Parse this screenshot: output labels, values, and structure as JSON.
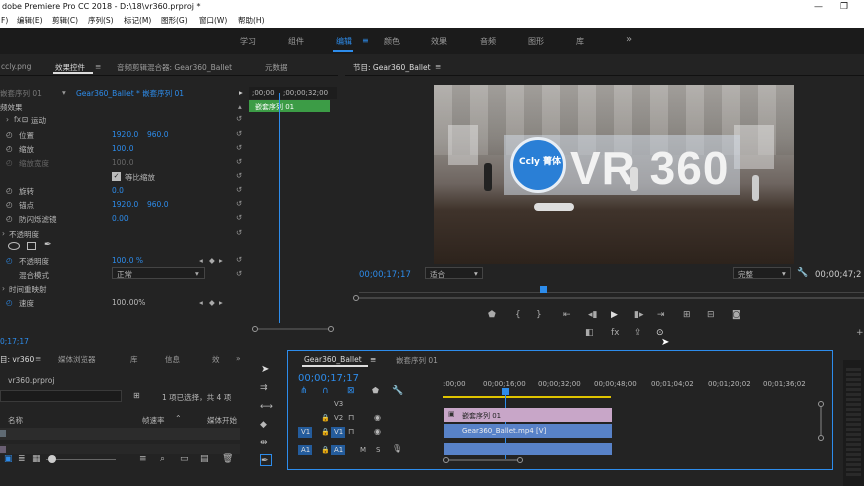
{
  "titlebar": {
    "text": "dobe Premiere Pro CC 2018 - D:\\18\\vr360.prproj *",
    "minimize": "—",
    "restore": "❐"
  },
  "menu": [
    "F)",
    "编辑(E)",
    "剪辑(C)",
    "序列(S)",
    "标记(M)",
    "图形(G)",
    "窗口(W)",
    "帮助(H)"
  ],
  "workspaces": [
    "学习",
    "组件",
    "编辑",
    "颜色",
    "效果",
    "音频",
    "图形",
    "库"
  ],
  "workspace_active_index": 2,
  "left_panel": {
    "tabs": [
      "ccly.png",
      "效果控件",
      "音频剪辑混合器: Gear360_Ballet",
      "元数据"
    ],
    "clip_path_left": "嵌套序列 01",
    "clip_path_right": "Gear360_Ballet * 嵌套序列 01",
    "video_effects": "频效果",
    "motion": "运动",
    "properties": [
      {
        "name": "位置",
        "v1": "1920.0",
        "v2": "960.0"
      },
      {
        "name": "缩放",
        "v1": "100.0",
        "v2": ""
      },
      {
        "name": "缩放宽度",
        "v1": "100.0",
        "v2": ""
      },
      {
        "name": "旋转",
        "v1": "0.0",
        "v2": ""
      },
      {
        "name": "锚点",
        "v1": "1920.0",
        "v2": "960.0"
      },
      {
        "name": "防闪烁滤镜",
        "v1": "0.00",
        "v2": ""
      }
    ],
    "uniform_scale": "等比缩放",
    "opacity": "不透明度",
    "opacity_value": "100.0 %",
    "blend_mode_label": "混合模式",
    "blend_mode_value": "正常",
    "time_remap": "时间重映射",
    "speed_label": "速度",
    "speed_value": "100.00%",
    "timecode": "0;17;17",
    "mini_ruler": [
      ";00;00",
      ";00;00;32;00"
    ],
    "mini_clip": "嵌套序列 01"
  },
  "program": {
    "title": "节目: Gear360_Ballet",
    "video_text": "VR 360",
    "logo_text": "Ccly 菁体",
    "timecode": "00;00;17;17",
    "fit": "适合",
    "quality": "完整",
    "duration": "00;00;47;2"
  },
  "project": {
    "tabs": [
      "目: vr360",
      "媒体浏览器",
      "库",
      "信息",
      "效"
    ],
    "file": "vr360.prproj",
    "selection": "1 项已选择，共 4 项",
    "col_name": "名称",
    "col_rate": "帧速率",
    "col_start": "媒体开始"
  },
  "timeline": {
    "tabs": [
      "Gear360_Ballet",
      "嵌套序列 01"
    ],
    "timecode": "00;00;17;17",
    "ruler": [
      ":00;00",
      "00;00;16;00",
      "00;00;32;00",
      "00;00;48;00",
      "00;01;04;02",
      "00;01;20;02",
      "00;01;36;02"
    ],
    "tracks": [
      "V3",
      "V2",
      "V1",
      "A1"
    ],
    "clip_nested": "嵌套序列 01",
    "clip_video": "Gear360_Ballet.mp4 [V]",
    "track_src": "V1",
    "track_src_a": "A1",
    "mute": "M",
    "solo": "S"
  },
  "colors": {
    "accent": "#2d8ceb",
    "clip_green": "#3c9c46",
    "clip_blue": "#5882c8",
    "clip_pink": "#c8a6c8"
  }
}
